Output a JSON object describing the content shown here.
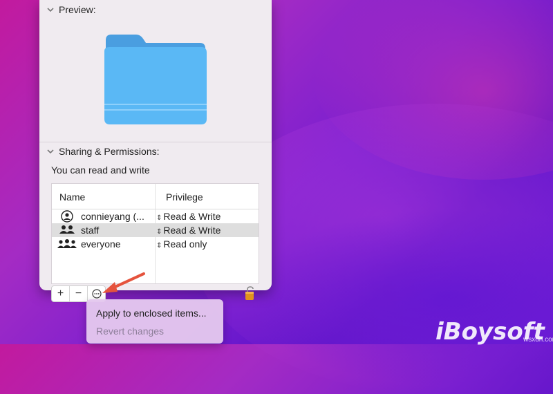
{
  "sections": {
    "preview": {
      "title": "Preview:"
    },
    "sharing": {
      "title": "Sharing & Permissions:",
      "subtitle": "You can read and write"
    }
  },
  "table": {
    "headers": {
      "name": "Name",
      "privilege": "Privilege"
    },
    "rows": [
      {
        "name": "connieyang (...",
        "privilege": "Read & Write",
        "icon": "user-icon",
        "selected": false
      },
      {
        "name": "staff",
        "privilege": "Read & Write",
        "icon": "group-icon",
        "selected": true
      },
      {
        "name": "everyone",
        "privilege": "Read only",
        "icon": "everyone-icon",
        "selected": false
      }
    ]
  },
  "toolbar": {
    "add": "+",
    "remove": "−",
    "more": "⋯"
  },
  "menu": {
    "apply": "Apply to enclosed items...",
    "revert": "Revert changes"
  },
  "watermark": {
    "logo": "iBoysoft",
    "site": "wsxdn.com"
  },
  "colors": {
    "folder": "#5ab8f5",
    "arrow": "#e5533d",
    "panel": "#f0ebf0"
  }
}
